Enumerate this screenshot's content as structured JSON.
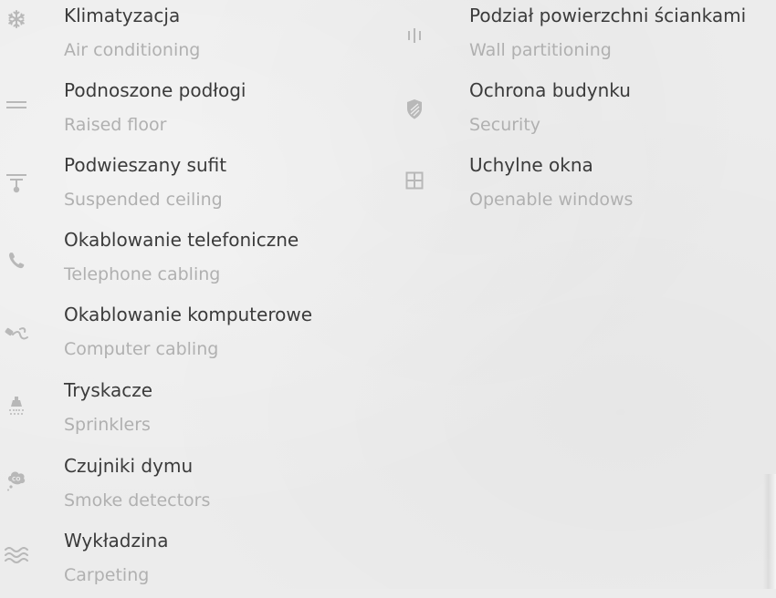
{
  "colors": {
    "background": "#ececec",
    "title": "#3b3b3b",
    "subtitle": "#b0b0b0",
    "icon": "#b8b8b8"
  },
  "features_left": [
    {
      "icon": "snowflake-icon",
      "title": "Klimatyzacja",
      "subtitle": "Air conditioning"
    },
    {
      "icon": "raised-floor-icon",
      "title": "Podnoszone podłogi",
      "subtitle": "Raised floor"
    },
    {
      "icon": "ceiling-lamp-icon",
      "title": "Podwieszany sufit",
      "subtitle": "Suspended ceiling"
    },
    {
      "icon": "phone-icon",
      "title": "Okablowanie telefoniczne",
      "subtitle": "Telephone cabling"
    },
    {
      "icon": "network-cable-icon",
      "title": "Okablowanie komputerowe",
      "subtitle": "Computer cabling"
    },
    {
      "icon": "sprinkler-icon",
      "title": "Tryskacze",
      "subtitle": "Sprinklers"
    },
    {
      "icon": "smoke-detector-icon",
      "title": "Czujniki dymu",
      "subtitle": "Smoke detectors"
    },
    {
      "icon": "carpet-waves-icon",
      "title": "Wykładzina",
      "subtitle": "Carpeting"
    }
  ],
  "features_right": [
    {
      "icon": "wall-partition-icon",
      "title": "Podział powierzchni ściankami",
      "subtitle": "Wall partitioning"
    },
    {
      "icon": "shield-icon",
      "title": "Ochrona budynku",
      "subtitle": "Security"
    },
    {
      "icon": "window-icon",
      "title": "Uchylne okna",
      "subtitle": "Openable windows"
    }
  ]
}
